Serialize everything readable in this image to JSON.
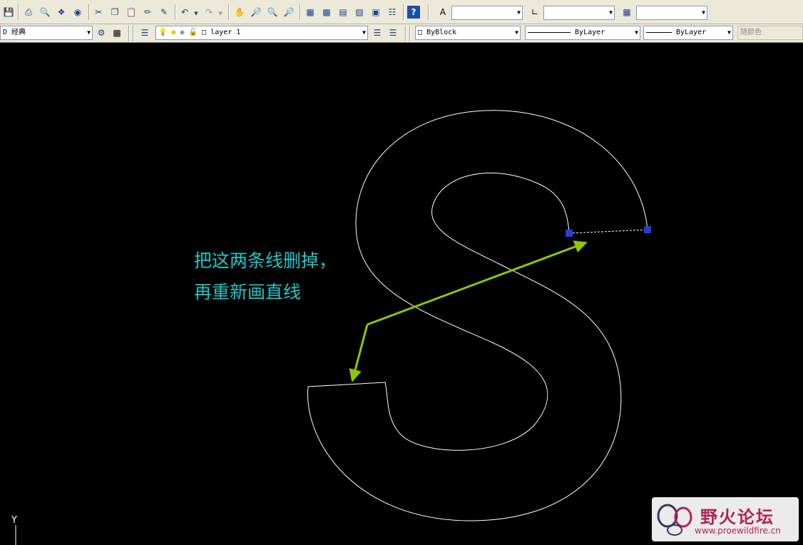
{
  "toolbar": {
    "text_style_value": "",
    "dim_style_value": "",
    "table_style_value": "",
    "workspace": "D 经典",
    "layer": "layer 1",
    "color": "ByBlock",
    "linetype": "ByLayer",
    "lineweight": "ByLayer",
    "plotstyle": "随颜色"
  },
  "canvas": {
    "annotation_line1": "把这两条线删掉，",
    "annotation_line2": "再重新画直线",
    "ucs_y_label": "Y",
    "colors": {
      "background": "#000000",
      "curve": "#ffffff",
      "grip": "#1f3fe0",
      "arrow": "#8bc800",
      "note": "#1dc8c8"
    }
  },
  "watermark": {
    "title": "野火论坛",
    "url": "www.proewildfire.cn"
  }
}
